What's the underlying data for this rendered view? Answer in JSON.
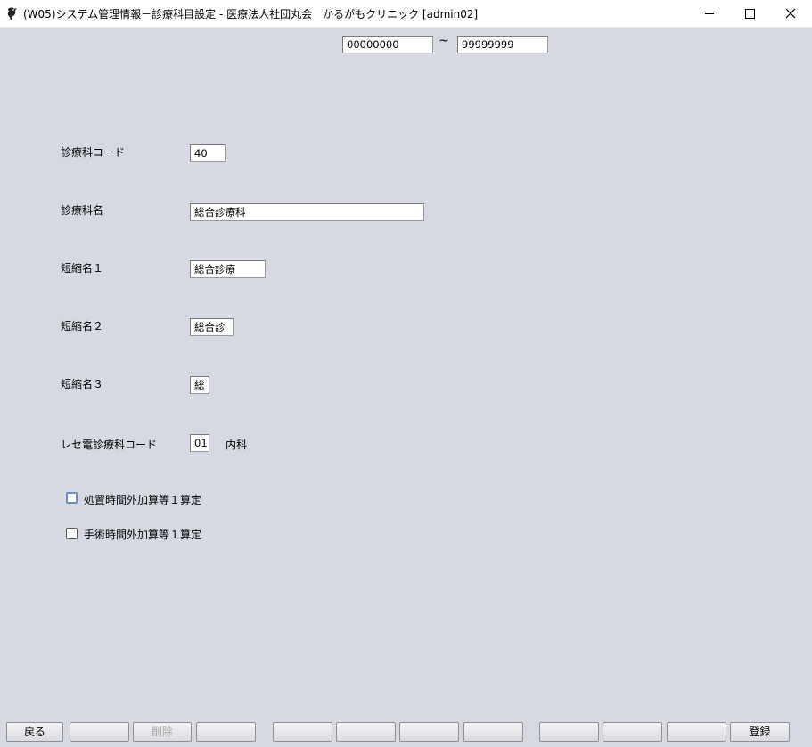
{
  "window": {
    "title": "(W05)システム管理情報－診療科目設定 - 医療法人社団丸会　かるがもクリニック [admin02]"
  },
  "range": {
    "from": "00000000",
    "separator": "~",
    "to": "99999999"
  },
  "form": {
    "dept_code_label": "診療科コード",
    "dept_code_value": "40",
    "dept_name_label": "診療科名",
    "dept_name_value": "総合診療科",
    "short1_label": "短縮名１",
    "short1_value": "総合診療",
    "short2_label": "短縮名２",
    "short2_value": "総合診",
    "short3_label": "短縮名３",
    "short3_value": "総",
    "rece_code_label": "レセ電診療科コード",
    "rece_code_value": "01",
    "rece_code_name": "内科",
    "checkbox1_label": "処置時間外加算等１算定",
    "checkbox1_checked": false,
    "checkbox2_label": "手術時間外加算等１算定",
    "checkbox2_checked": false
  },
  "function_keys": [
    {
      "label": "戻る",
      "enabled": true
    },
    {
      "label": "",
      "enabled": true
    },
    {
      "label": "削除",
      "enabled": false
    },
    {
      "label": "",
      "enabled": true
    },
    {
      "label": "",
      "enabled": true
    },
    {
      "label": "",
      "enabled": true
    },
    {
      "label": "",
      "enabled": true
    },
    {
      "label": "",
      "enabled": true
    },
    {
      "label": "",
      "enabled": true
    },
    {
      "label": "",
      "enabled": true
    },
    {
      "label": "",
      "enabled": true
    },
    {
      "label": "登録",
      "enabled": true
    }
  ]
}
